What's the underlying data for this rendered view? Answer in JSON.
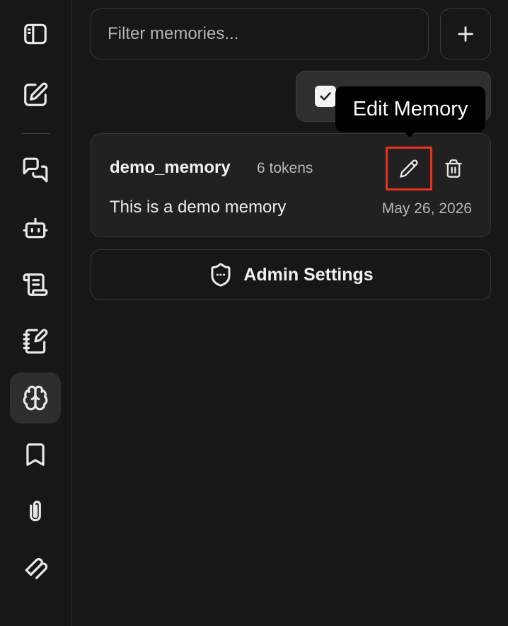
{
  "sidebar": {
    "items": [
      {
        "name": "toggle-sidebar",
        "icon": "sidebar-panel-icon"
      },
      {
        "name": "new-chat",
        "icon": "pen-square-icon"
      },
      {
        "name": "chats",
        "icon": "chat-bubbles-icon"
      },
      {
        "name": "agents",
        "icon": "bot-icon"
      },
      {
        "name": "prompts",
        "icon": "scroll-icon"
      },
      {
        "name": "notebook",
        "icon": "notebook-pen-icon"
      },
      {
        "name": "memories",
        "icon": "brain-icon",
        "active": true
      },
      {
        "name": "bookmarks",
        "icon": "bookmark-icon"
      },
      {
        "name": "attachments",
        "icon": "paperclip-icon"
      },
      {
        "name": "tools",
        "icon": "tools-icon"
      }
    ]
  },
  "search": {
    "placeholder": "Filter memories..."
  },
  "toolbar": {
    "add_icon": "plus-icon",
    "toggle_checked": true
  },
  "tooltip": {
    "text": "Edit Memory"
  },
  "memories": [
    {
      "key": "demo_memory",
      "tokens": "6 tokens",
      "value": "This is a demo memory",
      "date": "May 26, 2026"
    }
  ],
  "admin": {
    "label": "Admin Settings",
    "icon": "shield-icon"
  },
  "colors": {
    "background": "#171717",
    "card": "#212121",
    "highlight": "#e8321e"
  }
}
